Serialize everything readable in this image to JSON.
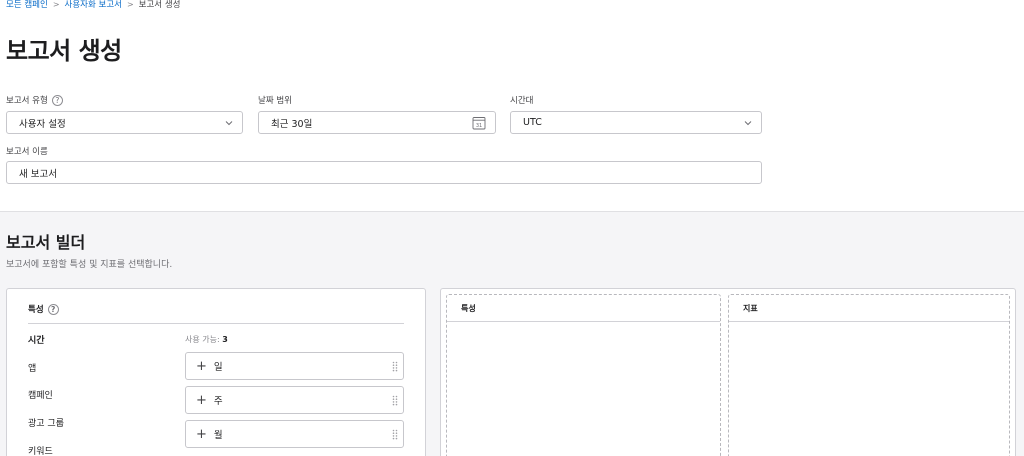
{
  "breadcrumb": {
    "items": [
      "모든 캠페인",
      "사용자화 보고서"
    ],
    "current": "보고서 생성"
  },
  "page_title": "보고서 생성",
  "form": {
    "report_type": {
      "label": "보고서 유형",
      "value": "사용자 설정",
      "help": "?"
    },
    "date_range": {
      "label": "날짜 범위",
      "value": "최근 30일",
      "calendar_day": "31"
    },
    "timezone": {
      "label": "시간대",
      "value": "UTC"
    },
    "report_name": {
      "label": "보고서 이름",
      "value": "새 보고서"
    }
  },
  "builder": {
    "title": "보고서 빌더",
    "description": "보고서에 포함할 특성 및 지표를 선택합니다.",
    "attributes_panel": {
      "header": "특성",
      "help": "?",
      "categories": [
        "시간",
        "앱",
        "캠페인",
        "광고 그룹",
        "키워드"
      ],
      "active_category": 0,
      "available_label": "사용 가능:",
      "available_count": "3",
      "chips": [
        "일",
        "주",
        "월"
      ],
      "chip_add_symbol": "+"
    },
    "drop_zones": {
      "attributes_header": "특성",
      "metrics_header": "지표"
    }
  },
  "colors": {
    "link": "#0a6cc8",
    "builder_bg": "#f5f5f7",
    "border": "#c7c7cc"
  }
}
